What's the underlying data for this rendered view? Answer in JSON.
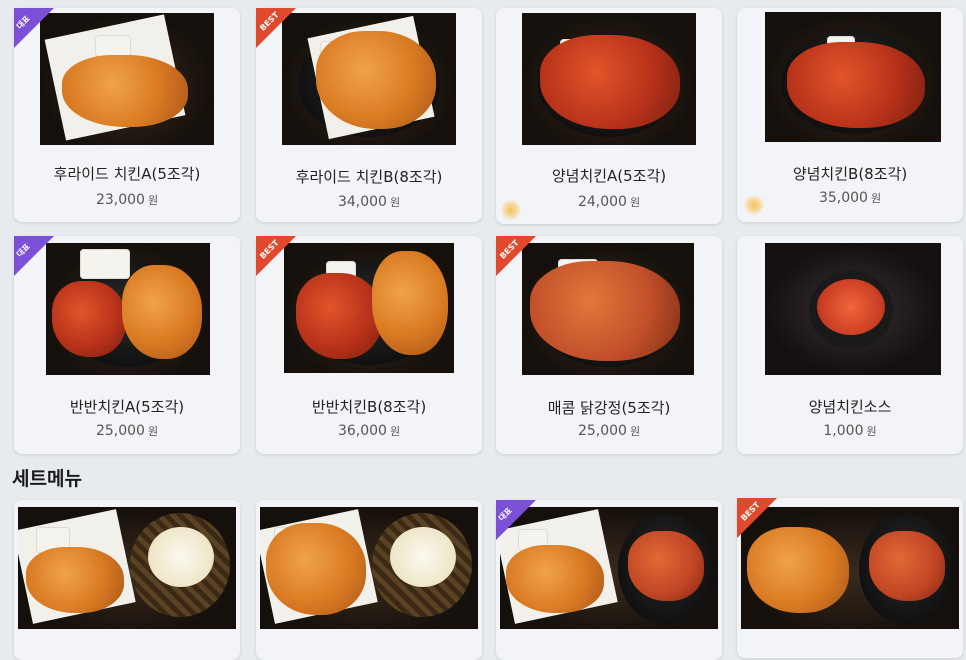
{
  "menu_items": [
    {
      "name": "후라이드 치킨A(5조각)",
      "price": "23,000",
      "won": "원",
      "badge": "대표"
    },
    {
      "name": "후라이드 치킨B(8조각)",
      "price": "34,000",
      "won": "원",
      "badge": "BEST"
    },
    {
      "name": "양념치킨A(5조각)",
      "price": "24,000",
      "won": "원",
      "badge": ""
    },
    {
      "name": "양념치킨B(8조각)",
      "price": "35,000",
      "won": "원",
      "badge": ""
    },
    {
      "name": "반반치킨A(5조각)",
      "price": "25,000",
      "won": "원",
      "badge": "대표"
    },
    {
      "name": "반반치킨B(8조각)",
      "price": "36,000",
      "won": "원",
      "badge": "BEST"
    },
    {
      "name": "매콤 닭강정(5조각)",
      "price": "25,000",
      "won": "원",
      "badge": "BEST"
    },
    {
      "name": "양념치킨소스",
      "price": "1,000",
      "won": "원",
      "badge": ""
    }
  ],
  "set_section": {
    "title": "세트메뉴",
    "badges": [
      "",
      "",
      "대표",
      "BEST"
    ]
  },
  "colors": {
    "badge_rep": "#7b4fd6",
    "badge_best": "#e0492c"
  }
}
